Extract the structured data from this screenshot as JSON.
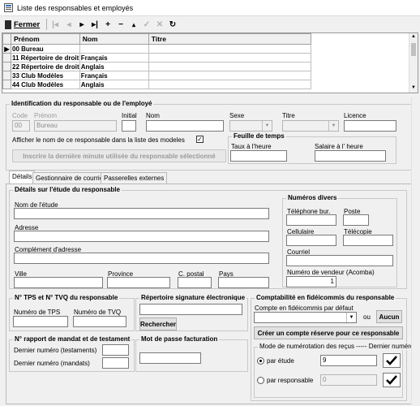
{
  "window": {
    "title": "Liste des responsables et employés"
  },
  "toolbar": {
    "close_label": "Fermer"
  },
  "grid": {
    "columns": [
      "Prénom",
      "Nom",
      "Titre"
    ],
    "rows": [
      {
        "prenom": "00 Bureau",
        "nom": "",
        "titre": ""
      },
      {
        "prenom": "11 Répertoire de droit",
        "nom": "Français",
        "titre": ""
      },
      {
        "prenom": "22 Répertoire de droit",
        "nom": "Anglais",
        "titre": ""
      },
      {
        "prenom": "33 Club Modèles",
        "nom": "Français",
        "titre": ""
      },
      {
        "prenom": "44 Club Modèles",
        "nom": "Anglais",
        "titre": ""
      }
    ]
  },
  "ident": {
    "title": "Identification du responsable ou de l'employé",
    "code_label": "Code",
    "code_value": "00",
    "prenom_label": "Prénom",
    "prenom_value": "Bureau",
    "initial_label": "Initial",
    "nom_label": "Nom",
    "sexe_label": "Sexe",
    "titre_label": "Titre",
    "licence_label": "Licence",
    "show_name_label": "Afficher le nom de ce responsable dans la liste des modeles",
    "insert_minute_label": "Inscrire la dernière minute utilisée du responsable sélectionné",
    "timesheet_title": "Feuille de temps",
    "hourly_rate_label": "Taux à l'heure",
    "hourly_salary_label": "Salaire à l' heure"
  },
  "tabs": [
    "Détails",
    "Gestionnaire de courriels",
    "Passerelles externes"
  ],
  "etude": {
    "title": "Détails sur l'étude du responsable",
    "nom_label": "Nom de l'étude",
    "adresse_label": "Adresse",
    "complement_label": "Complément d'adresse",
    "ville_label": "Ville",
    "province_label": "Province",
    "cpostal_label": "C. postal",
    "pays_label": "Pays"
  },
  "numeros": {
    "title": "Numéros divers",
    "tel_label": "Téléphone bur.",
    "poste_label": "Poste",
    "cell_label": "Cellulaire",
    "fax_label": "Télécopie",
    "email_label": "Courriel",
    "vendor_label": "Numéro de vendeur (Acomba)",
    "vendor_value": "1"
  },
  "tps": {
    "title": "N° TPS et N° TVQ du responsable",
    "tps_label": "Numéro de TPS",
    "tvq_label": "Numéro de TVQ"
  },
  "signature": {
    "title": "Répertoire signature électronique",
    "search_label": "Rechercher"
  },
  "fidei": {
    "title": "Comptabilité en fidéicommis du responsable",
    "default_label": "Compte en fidéicommis par défaut",
    "or_label": "ou",
    "none_label": "Aucun",
    "create_label": "Créer un compte réserve pour ce responsable",
    "numbering_title": "Mode de numérotation des reçus ----- Dernier numéro",
    "par_etude_label": "par étude",
    "par_etude_value": "9",
    "par_resp_label": "par responsable",
    "par_resp_value": "0"
  },
  "mandat": {
    "title": "N° rapport de mandat et de testament",
    "last_test_label": "Dernier numéro (testaments)",
    "last_mandat_label": "Dernier numéro (mandats)"
  },
  "password": {
    "title": "Mot de passe facturation"
  }
}
